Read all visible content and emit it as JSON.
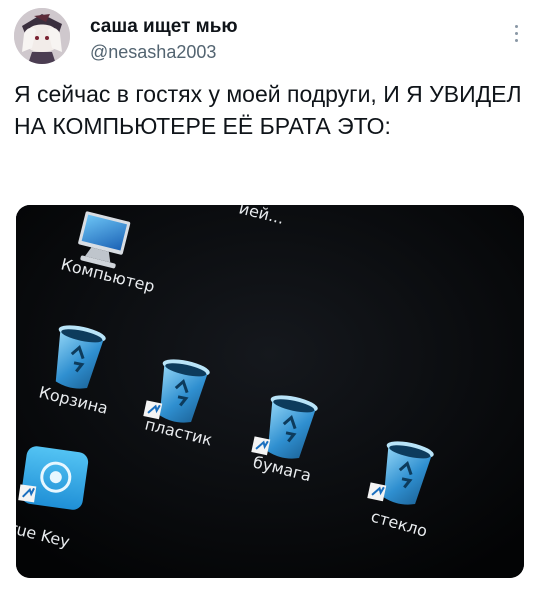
{
  "tweet": {
    "display_name": "саша ищет мью",
    "handle": "@nesasha2003",
    "text": "Я сейчас в гостях у моей подруги, И Я УВИДЕЛ НА КОМПЬЮТЕРЕ ЕЁ БРАТА ЭТО:"
  },
  "desktop": {
    "icons": [
      {
        "name": "computer-icon",
        "label": "Компьютер"
      },
      {
        "name": "recycle-bin-icon",
        "label": "Корзина"
      },
      {
        "name": "recycle-bin-shortcut-icon",
        "label": "пластик"
      },
      {
        "name": "recycle-bin-shortcut-icon",
        "label": "бумага"
      },
      {
        "name": "recycle-bin-shortcut-icon",
        "label": "стекло"
      },
      {
        "name": "true-key-icon",
        "label": "True Key"
      }
    ],
    "partial_top_label": "ией..."
  },
  "colors": {
    "text_primary": "#0f1419",
    "text_secondary": "#536471",
    "screen_bg": "#050608",
    "bin_blue": "#2f8fd0",
    "truekey_blue": "#29a6e8"
  }
}
